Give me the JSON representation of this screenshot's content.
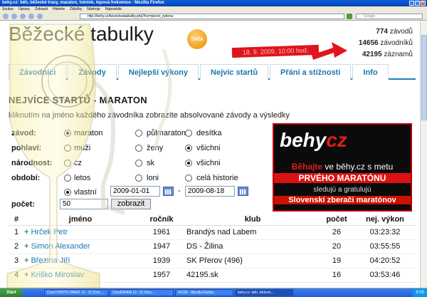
{
  "window": {
    "title": "behy.cz: běh, běžecké trasy, maraton, trénink, tepová frekvence - Mozilla Firefox",
    "menu": [
      "Soubor",
      "Úpravy",
      "Zobrazit",
      "Historie",
      "Záložky",
      "Nástroje",
      "Nápověda"
    ],
    "url": "http://behy.cz/bezeckeatabulky.php?tce=pocet_vykonu",
    "search_placeholder": "Google"
  },
  "header": {
    "site_title": "Běžecké tabulky",
    "beta": "beta",
    "stats": [
      {
        "value": "774",
        "label": "závodů"
      },
      {
        "value": "14656",
        "label": "závodníků"
      },
      {
        "value": "42195",
        "label": "záznamů"
      }
    ],
    "date_badge": "18. 9. 2009, 10:00 hod."
  },
  "tabs": [
    "Závodníci",
    "Závody",
    "Nejlepší výkony",
    "Nejvíc startů",
    "Přání a stížnosti",
    "Info"
  ],
  "section": {
    "title": "NEJVÍCE STARTŮ - MARATON",
    "hint": "kliknutím na jméno každého závodníka zobrazíte absolvované závody a výsledky"
  },
  "form": {
    "zavod_label": "závod:",
    "zavod_options": [
      "maraton",
      "půlmaraton",
      "desítka"
    ],
    "pohlavi_label": "pohlaví:",
    "pohlavi_options": [
      "muži",
      "ženy",
      "všichni"
    ],
    "narodnost_label": "národnost:",
    "narodnost_options": [
      "cz",
      "sk",
      "všichni"
    ],
    "obdobi_label": "období:",
    "obdobi_options": [
      "letos",
      "loni",
      "celá historie",
      "vlastní"
    ],
    "date_from": "2009-01-01",
    "date_sep": "-",
    "date_to": "2009-08-18",
    "pocet_label": "počet:",
    "pocet_value": "50",
    "submit_label": "zobrazit"
  },
  "ad": {
    "logo_a": "behy",
    "logo_b": "cz",
    "line1_a": "Běhajte",
    "line1_b": " ve běhy.cz",
    "line1_c": " s metu",
    "line2": "PRVÉHO MARATÓNU",
    "line3": "sledujú a gratulujú",
    "line4": "Slovenskí zberači maratónov"
  },
  "table": {
    "headers": [
      "#",
      "jméno",
      "ročník",
      "klub",
      "počet",
      "nej. výkon"
    ],
    "rows": [
      [
        "1",
        "Hrček Petr",
        "1961",
        "Brandýs nad Labem",
        "26",
        "03:23:32"
      ],
      [
        "2",
        "Simon Alexander",
        "1947",
        "DS - Žilina",
        "20",
        "03:55:55"
      ],
      [
        "3",
        "Březina Jiří",
        "1939",
        "SK Přerov (496)",
        "19",
        "04:20:52"
      ],
      [
        "4",
        "Kriško Miroslav",
        "1957",
        "42195.sk",
        "16",
        "03:53:46"
      ]
    ]
  },
  "taskbar": {
    "start": "Start",
    "tasks": [
      "Corel PHOTO-PAINT 12 - [C:\\Doc...",
      "CorelDRAW 12 - [C:\\Doc...",
      "42195 - Mozilla Firefox",
      "behy.cz: běh, běžeck..."
    ],
    "clock": "9:55"
  },
  "colors": {
    "accent": "#1a77b3",
    "badge": "#e0141c",
    "ad_red": "#d11111"
  }
}
